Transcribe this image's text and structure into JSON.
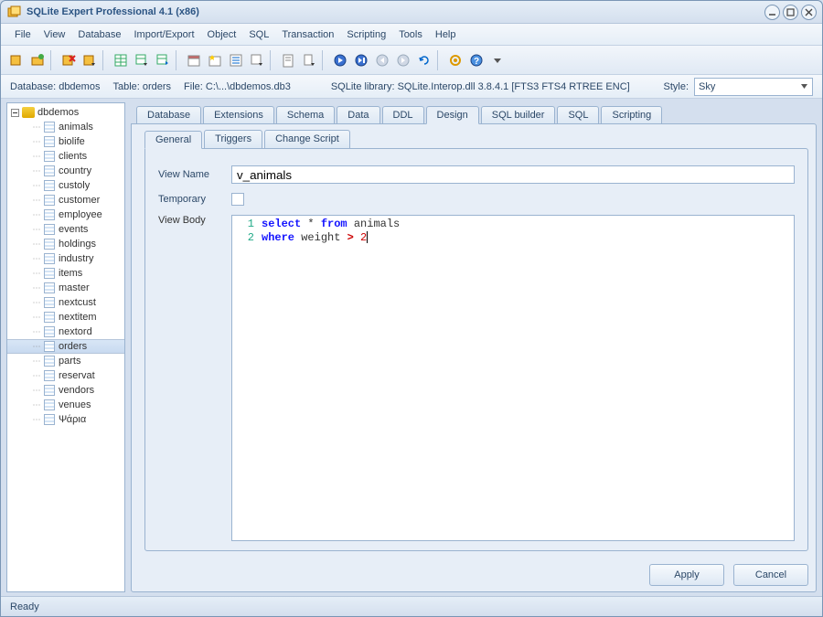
{
  "window": {
    "title": "SQLite Expert Professional 4.1 (x86)"
  },
  "menu": [
    "File",
    "View",
    "Database",
    "Import/Export",
    "Object",
    "SQL",
    "Transaction",
    "Scripting",
    "Tools",
    "Help"
  ],
  "info": {
    "database": "Database: dbdemos",
    "table": "Table: orders",
    "file": "File: C:\\...\\dbdemos.db3",
    "lib": "SQLite library: SQLite.Interop.dll 3.8.4.1 [FTS3 FTS4 RTREE ENC]",
    "style_label": "Style:",
    "style_value": "Sky"
  },
  "tree": {
    "root": "dbdemos",
    "items": [
      "animals",
      "biolife",
      "clients",
      "country",
      "custoly",
      "customer",
      "employee",
      "events",
      "holdings",
      "industry",
      "items",
      "master",
      "nextcust",
      "nextitem",
      "nextord",
      "orders",
      "parts",
      "reservat",
      "vendors",
      "venues",
      "Ψάρια"
    ],
    "selected": "orders"
  },
  "tabs": [
    "Database",
    "Extensions",
    "Schema",
    "Data",
    "DDL",
    "Design",
    "SQL builder",
    "SQL",
    "Scripting"
  ],
  "active_tab": "Design",
  "subtabs": [
    "General",
    "Triggers",
    "Change Script"
  ],
  "active_subtab": "General",
  "form": {
    "view_name_label": "View Name",
    "view_name_value": "v_animals",
    "temporary_label": "Temporary",
    "view_body_label": "View Body"
  },
  "code": {
    "line1_a": "select",
    "line1_b": " * ",
    "line1_c": "from",
    "line1_d": " animals",
    "line2_a": "where",
    "line2_b": " weight ",
    "line2_c": ">",
    "line2_d": " 2"
  },
  "buttons": {
    "apply": "Apply",
    "cancel": "Cancel"
  },
  "status": "Ready"
}
